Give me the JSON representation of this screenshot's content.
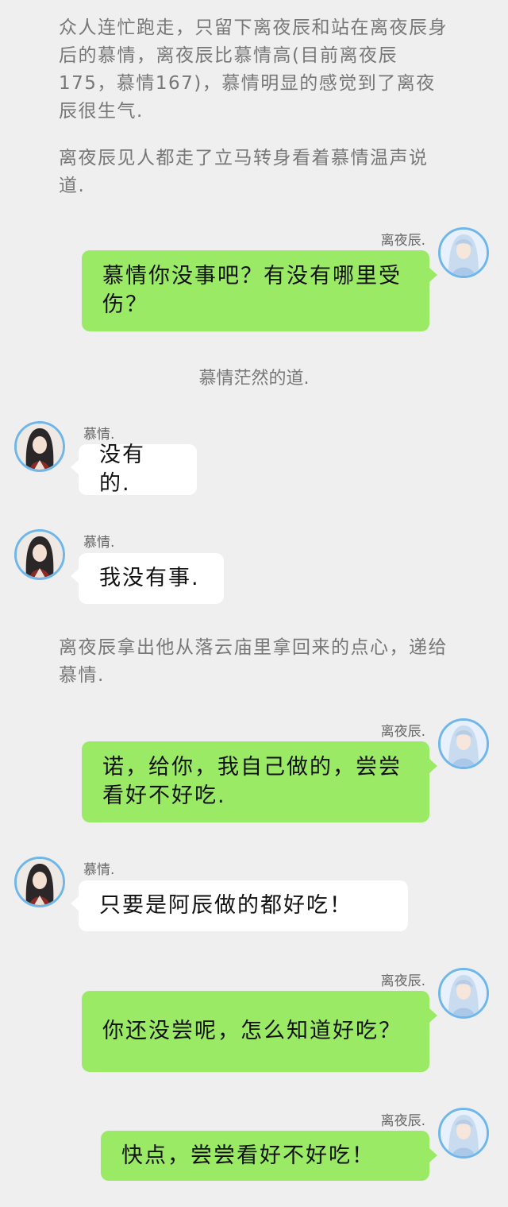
{
  "narration": [
    "众人连忙跑走，只留下离夜辰和站在离夜辰身后的慕情，离夜辰比慕情高(目前离夜辰175，慕情167)，慕情明显的感觉到了离夜辰很生气.",
    "离夜辰见人都走了立马转身看着慕情温声说道.",
    "离夜辰拿出他从落云庙里拿回来的点心，递给慕情."
  ],
  "system_note": "慕情茫然的道.",
  "messages": [
    {
      "sender": "离夜辰.",
      "side": "right",
      "text": "慕情你没事吧？有没有哪里受伤？"
    },
    {
      "sender": "慕情.",
      "side": "left",
      "text": "没有的."
    },
    {
      "sender": "慕情.",
      "side": "left",
      "text": "我没有事."
    },
    {
      "sender": "离夜辰.",
      "side": "right",
      "text": "诺，给你，我自己做的，尝尝看好不好吃."
    },
    {
      "sender": "慕情.",
      "side": "left",
      "text": "只要是阿辰做的都好吃！"
    },
    {
      "sender": "离夜辰.",
      "side": "right",
      "text": "你还没尝呢，怎么知道好吃？"
    },
    {
      "sender": "离夜辰.",
      "side": "right",
      "text": "快点，尝尝看好不好吃！"
    }
  ],
  "colors": {
    "background": "#efefef",
    "bubble_green": "#9bea65",
    "bubble_white": "#ffffff",
    "avatar_ring": "#6fb7ea"
  },
  "icons": {
    "right_avatar": "white-haired-character-avatar",
    "left_avatar": "dark-haired-character-avatar"
  }
}
